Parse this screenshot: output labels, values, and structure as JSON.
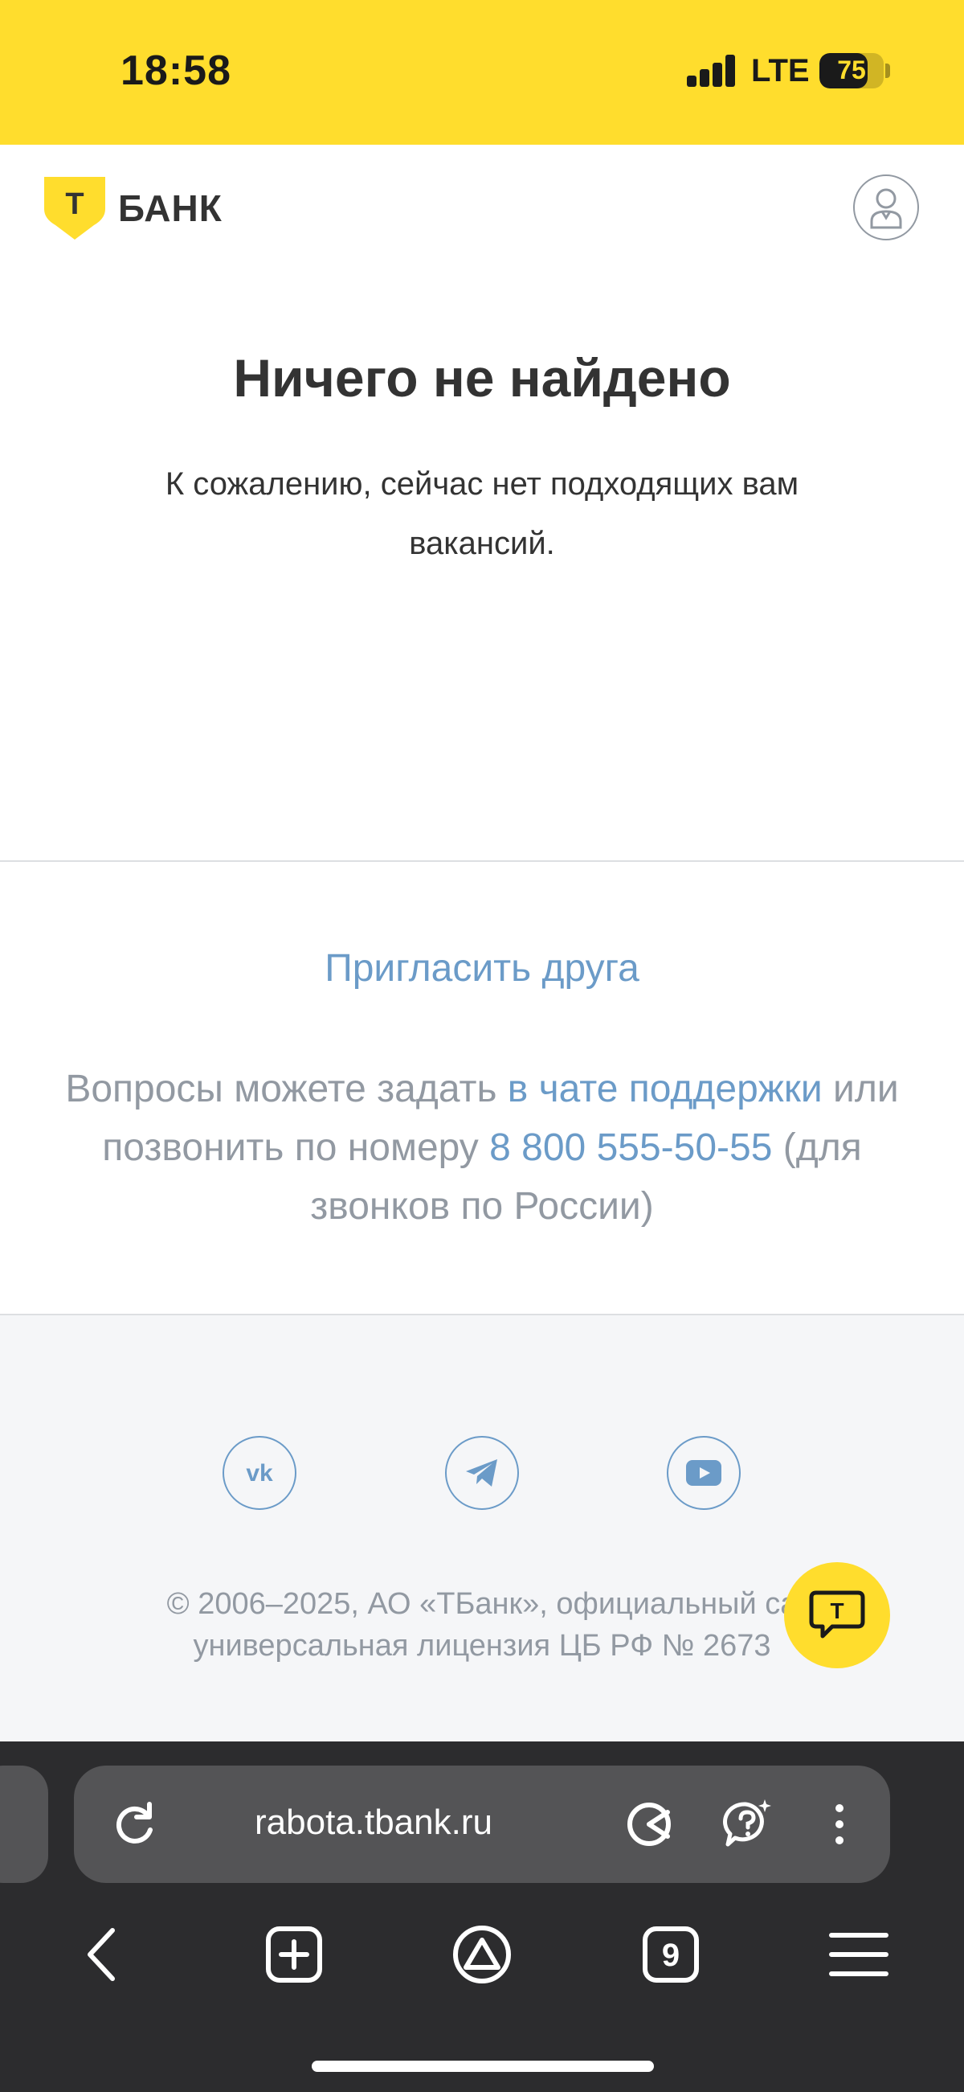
{
  "status_bar": {
    "time": "18:58",
    "network": "LTE",
    "battery": "75",
    "battery_level_percent": 75,
    "background_color": "#ffdd2d"
  },
  "header": {
    "logo_letter": "Т",
    "logo_text": "БАНК",
    "profile_icon": "user-profile-icon"
  },
  "main": {
    "title": "Ничего не найдено",
    "subtitle": "К сожалению, сейчас нет подходящих вам вакансий."
  },
  "contact": {
    "invite_link": "Пригласить друга",
    "text_before_chat": "Вопросы можете задать ",
    "chat_link": "в чате поддержки",
    "text_before_phone": " или позвонить по номеру ",
    "phone": "8 800 555-50-55",
    "text_after_phone": " (для звонков по России)",
    "link_color": "#6b9bc8"
  },
  "footer": {
    "social": [
      {
        "name": "vk",
        "icon": "vk-icon"
      },
      {
        "name": "telegram",
        "icon": "telegram-icon"
      },
      {
        "name": "youtube",
        "icon": "youtube-icon"
      }
    ],
    "copyright_line1": "© 2006–2025, АО «ТБанк», официальный са",
    "copyright_line2": "универсальная лицензия ЦБ РФ № 2673",
    "chat_button_letter": "Т"
  },
  "browser": {
    "url": "rabota.tbank.ru",
    "tab_count": "9",
    "toolbar_icons": [
      "reload-icon",
      "pacman-icon",
      "ai-assistant-icon",
      "more-vertical-icon"
    ],
    "nav_icons": [
      "back-icon",
      "new-tab-icon",
      "alice-icon",
      "tabs-icon",
      "menu-icon"
    ]
  }
}
